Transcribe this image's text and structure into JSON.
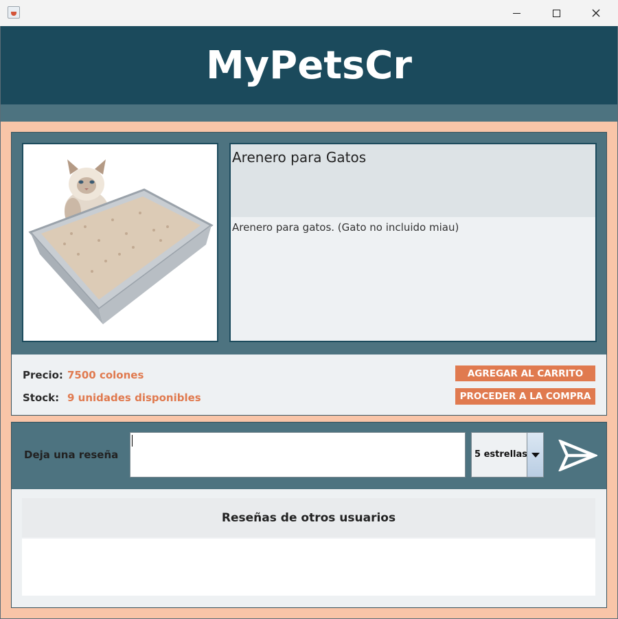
{
  "window": {
    "icon": "java-cup-icon",
    "controls": [
      "minimize-icon",
      "maximize-icon",
      "close-icon"
    ]
  },
  "header": {
    "title": "MyPetsCr"
  },
  "product": {
    "image": "cat-litter-box-with-cat-photo",
    "name": "Arenero para Gatos",
    "description": "Arenero para gatos. (Gato no incluido miau)",
    "price_label": "Precio:",
    "price_value": "7500 colones",
    "stock_label": "Stock:",
    "stock_value": "9 unidades disponibles",
    "add_to_cart": "AGREGAR AL CARRITO",
    "proceed": "PROCEDER A LA COMPRA"
  },
  "review": {
    "label": "Deja una reseña",
    "input_value": "",
    "stars_selected": "5 estrellas",
    "send_icon": "send-arrow-icon"
  },
  "reviews": {
    "heading": "Reseñas de otros usuarios",
    "items": []
  },
  "colors": {
    "header_bg": "#1b4a5c",
    "panel_bg": "#4d7380",
    "frame_bg": "#f9c5a8",
    "accent": "#e07a4f"
  }
}
